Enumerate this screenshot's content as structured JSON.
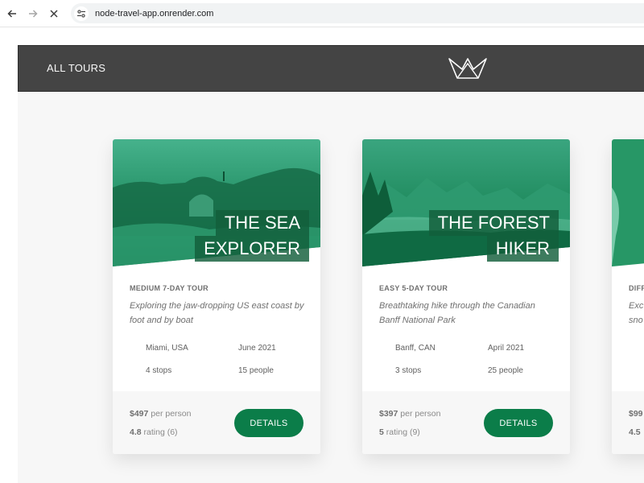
{
  "browser": {
    "url": "node-travel-app.onrender.com"
  },
  "header": {
    "nav_label": "ALL TOURS"
  },
  "colors": {
    "header_bg": "#444444",
    "accent_green": "#0b7d49",
    "page_bg": "#f7f7f7"
  },
  "tours": [
    {
      "title_line1": "THE SEA",
      "title_line2": "EXPLORER",
      "type": "MEDIUM 7-DAY TOUR",
      "summary": "Exploring the jaw-dropping US east coast by foot and by boat",
      "location": "Miami, USA",
      "date": "June 2021",
      "stops": "4 stops",
      "people": "15 people",
      "price": "$497",
      "price_suffix": "per person",
      "rating": "4.8",
      "rating_suffix": "rating (6)",
      "button": "DETAILS"
    },
    {
      "title_line1": "THE FOREST",
      "title_line2": "HIKER",
      "type": "EASY 5-DAY TOUR",
      "summary": "Breathtaking hike through the Canadian Banff National Park",
      "location": "Banff, CAN",
      "date": "April 2021",
      "stops": "3 stops",
      "people": "25 people",
      "price": "$397",
      "price_suffix": "per person",
      "rating": "5",
      "rating_suffix": "rating (9)",
      "button": "DETAILS"
    },
    {
      "type": "DIFF",
      "summary": "Exc sno",
      "price": "$99",
      "rating": "4.5"
    }
  ]
}
